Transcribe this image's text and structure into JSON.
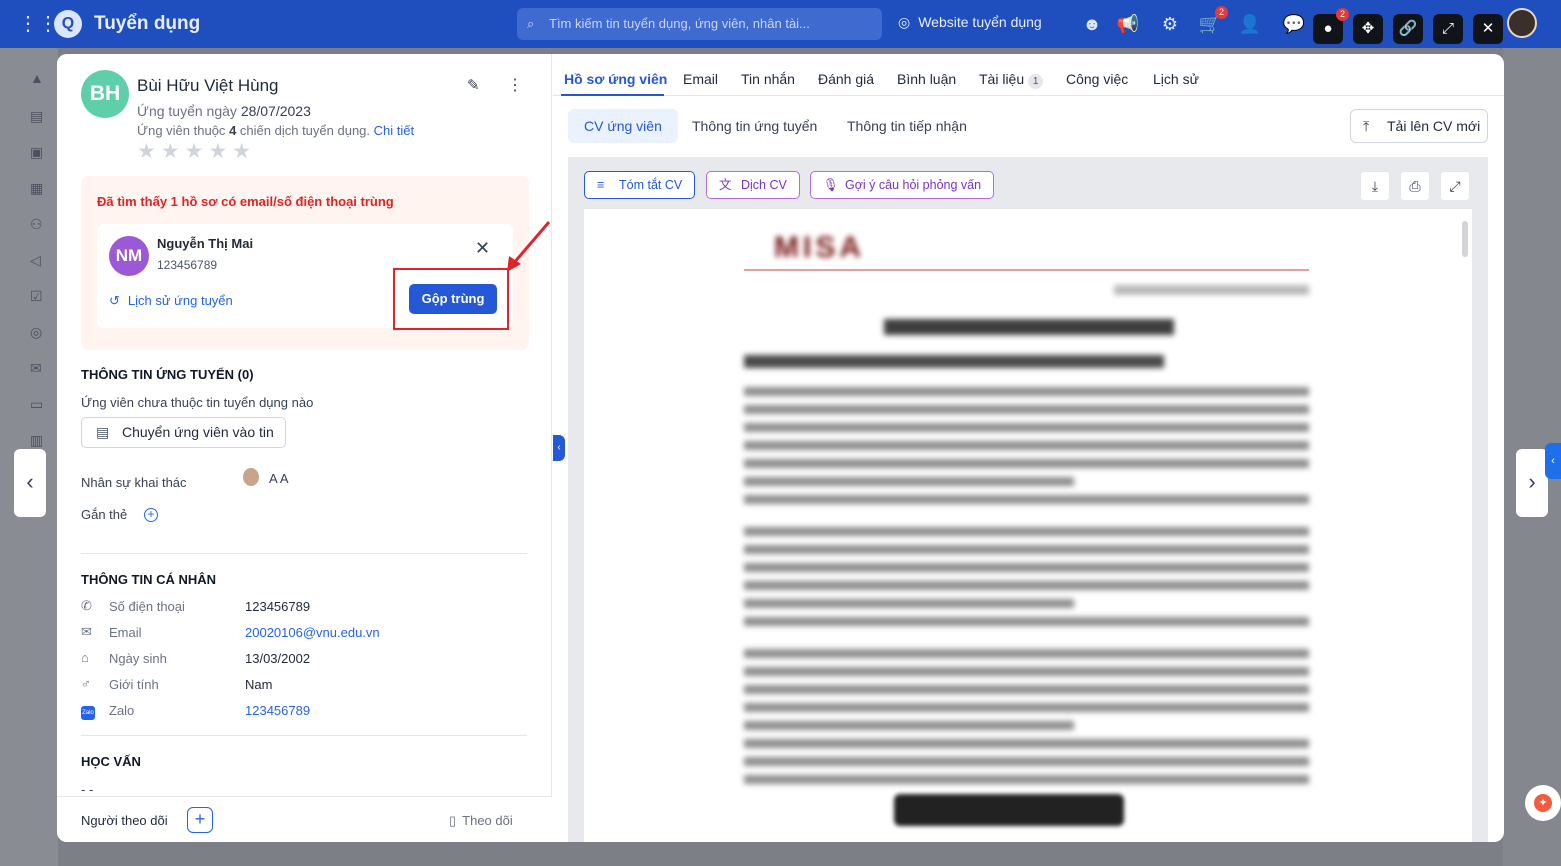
{
  "app": {
    "title": "Tuyển dụng",
    "search_placeholder": "Tìm kiếm tin tuyển dụng, ứng viên, nhân tài...",
    "website_label": "Website tuyển dụng",
    "badge_cart": "2",
    "badge_chat": "2"
  },
  "candidate": {
    "initials": "BH",
    "name": "Bùi Hữu Việt Hùng",
    "applied_label": "Ứng tuyển ngày",
    "applied_date": "28/07/2023",
    "campaign_prefix": "Ứng viên thuộc",
    "campaign_count": "4",
    "campaign_suffix": "chiến dịch tuyển dụng.",
    "campaign_link": "Chi tiết",
    "stars": "★★★★★"
  },
  "duplicate": {
    "title": "Đã tìm thấy 1 hồ sơ có email/số điện thoại trùng",
    "initials": "NM",
    "name": "Nguyễn Thị Mai",
    "phone": "123456789",
    "history_link": "Lịch sử ứng tuyển",
    "merge_button": "Gộp trùng"
  },
  "application": {
    "title": "THÔNG TIN ỨNG TUYỂN (0)",
    "none_text": "Ứng viên chưa thuộc tin tuyển dụng nào",
    "move_button": "Chuyển ứng viên vào tin",
    "staff_label": "Nhân sự khai thác",
    "staff_name": "A A",
    "tag_label": "Gắn thẻ"
  },
  "personal": {
    "title": "THÔNG TIN CÁ NHÂN",
    "rows": [
      {
        "label": "Số điện thoại",
        "value": "123456789"
      },
      {
        "label": "Email",
        "value": "20020106@vnu.edu.vn"
      },
      {
        "label": "Ngày sinh",
        "value": "13/03/2002"
      },
      {
        "label": "Giới tính",
        "value": "Nam"
      },
      {
        "label": "Zalo",
        "value": "123456789"
      }
    ]
  },
  "education": {
    "title": "HỌC VẤN",
    "value": "- -"
  },
  "footer": {
    "followers_label": "Người theo dõi",
    "follow_button": "Theo dõi"
  },
  "tabs": [
    "Hồ sơ ứng viên",
    "Email",
    "Tin nhắn",
    "Đánh giá",
    "Bình luận",
    "Tài liệu",
    "Công việc",
    "Lịch sử"
  ],
  "tab_doc_count": "1",
  "subtabs": [
    "CV ứng viên",
    "Thông tin ứng tuyển",
    "Thông tin tiếp nhận"
  ],
  "upload_button": "Tải lên CV mới",
  "ai_buttons": [
    "Tóm tắt CV",
    "Dịch CV",
    "Gợi ý câu hỏi phỏng vấn"
  ],
  "colors": {
    "primary": "#2458d6",
    "danger": "#dc2626",
    "ai": "#7a33c7"
  }
}
